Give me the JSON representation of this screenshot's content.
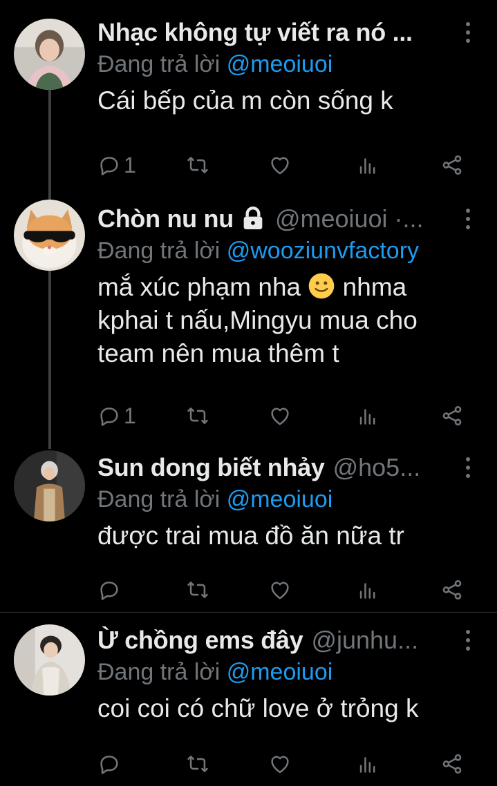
{
  "tweets": [
    {
      "name": "Nhạc không tự viết ra nó ...",
      "handle": "",
      "reply_prefix": "Đang trả lời",
      "reply_mention": "@meoiuoi",
      "text": "Cái bếp của m còn sống k",
      "reply_count": "1"
    },
    {
      "name": "Chòn nu nu",
      "handle": "@meoiuoi ·...",
      "reply_prefix": "Đang trả lời",
      "reply_mention": "@wooziunvfactory",
      "text_lines": [
        "mắ xúc phạm nha",
        "nhma",
        "kphai t nấu,Mingyu mua cho",
        "team nên mua thêm t"
      ],
      "reply_count": "1"
    },
    {
      "name": "Sun dong biết nhảy",
      "handle": "@ho5...",
      "reply_prefix": "Đang trả lời",
      "reply_mention": "@meoiuoi",
      "text": "được trai mua đồ ăn nữa tr",
      "reply_count": ""
    },
    {
      "name": "Ừ chồng ems đây",
      "handle": "@junhu...",
      "reply_prefix": "Đang trả lời",
      "reply_mention": "@meoiuoi",
      "text": "coi coi có chữ love ở trỏng k",
      "reply_count": ""
    }
  ],
  "icons": {
    "reply": "reply-icon",
    "retweet": "retweet-icon",
    "like": "heart-icon",
    "views": "views-icon",
    "share": "share-icon",
    "more": "more-vertical-icon",
    "lock": "lock-icon",
    "emoji": "slightly-smiling-face-emoji"
  },
  "colors": {
    "background": "#000000",
    "text": "#e7e9ea",
    "muted": "#71767b",
    "mention": "#1d9bf0"
  }
}
